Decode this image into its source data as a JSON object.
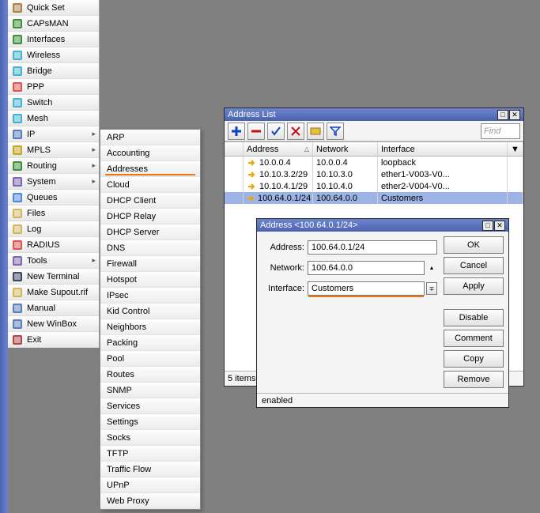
{
  "sidebar": [
    {
      "label": "Quick Set",
      "icon": "quickset"
    },
    {
      "label": "CAPsMAN",
      "icon": "capsman"
    },
    {
      "label": "Interfaces",
      "icon": "interfaces"
    },
    {
      "label": "Wireless",
      "icon": "wireless"
    },
    {
      "label": "Bridge",
      "icon": "bridge"
    },
    {
      "label": "PPP",
      "icon": "ppp"
    },
    {
      "label": "Switch",
      "icon": "switch"
    },
    {
      "label": "Mesh",
      "icon": "mesh"
    },
    {
      "label": "IP",
      "icon": "ip",
      "sub": true
    },
    {
      "label": "MPLS",
      "icon": "mpls",
      "sub": true
    },
    {
      "label": "Routing",
      "icon": "routing",
      "sub": true
    },
    {
      "label": "System",
      "icon": "system",
      "sub": true
    },
    {
      "label": "Queues",
      "icon": "queues"
    },
    {
      "label": "Files",
      "icon": "files"
    },
    {
      "label": "Log",
      "icon": "log"
    },
    {
      "label": "RADIUS",
      "icon": "radius"
    },
    {
      "label": "Tools",
      "icon": "tools",
      "sub": true
    },
    {
      "label": "New Terminal",
      "icon": "terminal"
    },
    {
      "label": "Make Supout.rif",
      "icon": "supout"
    },
    {
      "label": "Manual",
      "icon": "manual"
    },
    {
      "label": "New WinBox",
      "icon": "winbox"
    },
    {
      "label": "Exit",
      "icon": "exit"
    }
  ],
  "submenu": [
    {
      "label": "ARP"
    },
    {
      "label": "Accounting"
    },
    {
      "label": "Addresses",
      "hl": true
    },
    {
      "label": "Cloud"
    },
    {
      "label": "DHCP Client"
    },
    {
      "label": "DHCP Relay"
    },
    {
      "label": "DHCP Server"
    },
    {
      "label": "DNS"
    },
    {
      "label": "Firewall"
    },
    {
      "label": "Hotspot"
    },
    {
      "label": "IPsec"
    },
    {
      "label": "Kid Control"
    },
    {
      "label": "Neighbors"
    },
    {
      "label": "Packing"
    },
    {
      "label": "Pool"
    },
    {
      "label": "Routes"
    },
    {
      "label": "SNMP"
    },
    {
      "label": "Services"
    },
    {
      "label": "Settings"
    },
    {
      "label": "Socks"
    },
    {
      "label": "TFTP"
    },
    {
      "label": "Traffic Flow"
    },
    {
      "label": "UPnP"
    },
    {
      "label": "Web Proxy"
    }
  ],
  "addresslist": {
    "title": "Address List",
    "find_placeholder": "Find",
    "columns": {
      "addr": "Address",
      "net": "Network",
      "if": "Interface"
    },
    "rows": [
      {
        "addr": "10.0.0.4",
        "net": "10.0.0.4",
        "if": "loopback"
      },
      {
        "addr": "10.10.3.2/29",
        "net": "10.10.3.0",
        "if": "ether1-V003-V0..."
      },
      {
        "addr": "10.10.4.1/29",
        "net": "10.10.4.0",
        "if": "ether2-V004-V0..."
      },
      {
        "addr": "100.64.0.1/24",
        "net": "100.64.0.0",
        "if": "Customers",
        "sel": true
      }
    ],
    "count_label": "5 items"
  },
  "dlg": {
    "title": "Address <100.64.0.1/24>",
    "labels": {
      "addr": "Address:",
      "net": "Network:",
      "if": "Interface:"
    },
    "values": {
      "addr": "100.64.0.1/24",
      "net": "100.64.0.0",
      "if": "Customers"
    },
    "btns": {
      "ok": "OK",
      "cancel": "Cancel",
      "apply": "Apply",
      "disable": "Disable",
      "comment": "Comment",
      "copy": "Copy",
      "remove": "Remove"
    },
    "status": "enabled"
  },
  "icon_colors": {
    "quickset": "#a06a2a",
    "capsman": "#1e7e1e",
    "interfaces": "#1e7e1e",
    "wireless": "#2aa7c6",
    "bridge": "#2aa7c6",
    "ppp": "#d43a3a",
    "switch": "#2aa7c6",
    "mesh": "#2aa7c6",
    "ip": "#3e68b0",
    "mpls": "#b89a00",
    "routing": "#1e7e1e",
    "system": "#6a4ca5",
    "queues": "#3774d4",
    "files": "#caa94a",
    "log": "#caa94a",
    "radius": "#d43a3a",
    "tools": "#6a4ca5",
    "terminal": "#1d2a44",
    "supout": "#caa94a",
    "manual": "#3e68b0",
    "winbox": "#3e68b0",
    "exit": "#a02a2a"
  }
}
